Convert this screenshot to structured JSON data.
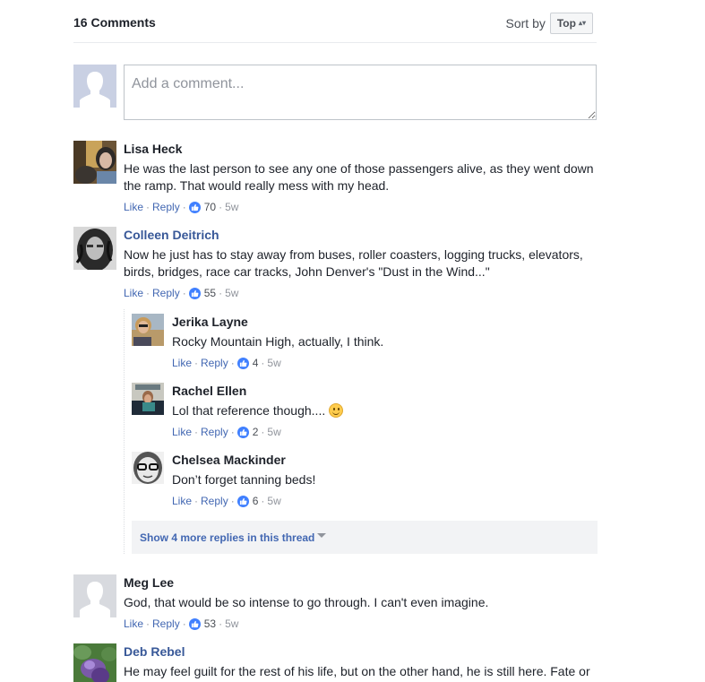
{
  "header": {
    "count_label": "16 Comments",
    "sort_label": "Sort by",
    "sort_value": "Top",
    "sort_arrows": "▴▾"
  },
  "composer": {
    "placeholder": "Add a comment...",
    "value": ""
  },
  "action_labels": {
    "like": "Like",
    "reply": "Reply",
    "separator": "·"
  },
  "comments": [
    {
      "name": "Lisa Heck",
      "name_is_link": false,
      "text": "He was the last person to see any one of those passengers alive, as they went down the ramp. That would really mess with my head.",
      "likes": "70",
      "time": "5w"
    },
    {
      "name": "Colleen Deitrich",
      "name_is_link": true,
      "text": "Now he just has to stay away from buses, roller coasters, logging trucks, elevators, birds, bridges, race car tracks, John Denver's \"Dust in the Wind...\"",
      "likes": "55",
      "time": "5w",
      "replies": [
        {
          "name": "Jerika Layne",
          "text": "Rocky Mountain High, actually, I think.",
          "likes": "4",
          "time": "5w"
        },
        {
          "name": "Rachel Ellen",
          "text": "Lol that reference though....",
          "emoji": "smiley-emoji",
          "likes": "2",
          "time": "5w"
        },
        {
          "name": "Chelsea Mackinder",
          "text": "Don’t forget tanning beds!",
          "likes": "6",
          "time": "5w"
        }
      ],
      "show_more_label": "Show 4 more replies in this thread"
    },
    {
      "name": "Meg Lee",
      "name_is_link": false,
      "text": "God, that would be so intense to go through. I can't even imagine.",
      "likes": "53",
      "time": "5w"
    },
    {
      "name": "Deb Rebel",
      "name_is_link": true,
      "text": "He may feel guilt for the rest of his life, but on the other hand, he is still here. Fate or"
    }
  ],
  "colors": {
    "link": "#385898",
    "action": "#4267b2",
    "like_badge": "#4080ff",
    "text": "#1d2129",
    "meta": "#90949c"
  }
}
